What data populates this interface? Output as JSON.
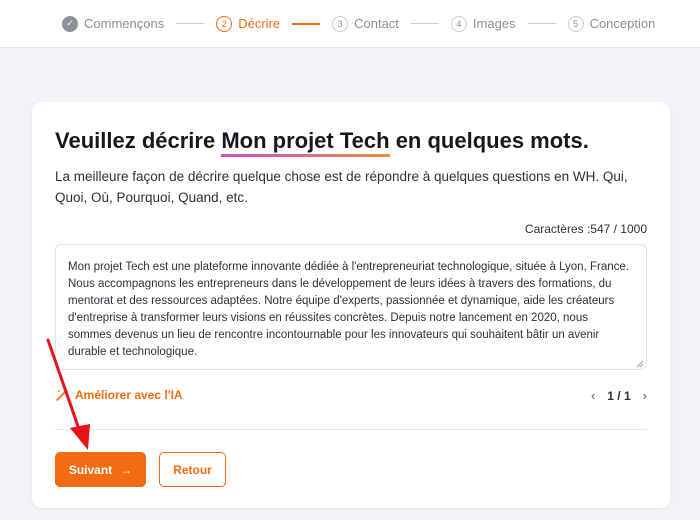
{
  "stepper": {
    "steps": [
      {
        "num": "✓",
        "label": "Commençons",
        "state": "done"
      },
      {
        "num": "2",
        "label": "Décrire",
        "state": "active"
      },
      {
        "num": "3",
        "label": "Contact",
        "state": "todo"
      },
      {
        "num": "4",
        "label": "Images",
        "state": "todo"
      },
      {
        "num": "5",
        "label": "Conception",
        "state": "todo"
      }
    ]
  },
  "card": {
    "title_pre": "Veuillez décrire ",
    "title_project": "Mon projet Tech",
    "title_post": " en quelques mots.",
    "subtitle": "La meilleure façon de décrire quelque chose est de répondre à quelques questions en WH. Qui, Quoi, Où, Pourquoi, Quand, etc.",
    "counter": "Caractères :547 / 1000",
    "description": "Mon projet Tech est une plateforme innovante dédiée à l'entrepreneuriat technologique, située à Lyon, France. Nous accompagnons les entrepreneurs dans le développement de leurs idées à travers des formations, du mentorat et des ressources adaptées. Notre équipe d'experts, passionnée et dynamique, aide les créateurs d'entreprise à transformer leurs visions en réussites concrètes. Depuis notre lancement en 2020, nous sommes devenus un lieu de rencontre incontournable pour les innovateurs qui souhaitent bâtir un avenir durable et technologique.",
    "ai_label": "Améliorer avec l'IA",
    "pager": "1 / 1",
    "next_label": "Suivant",
    "back_label": "Retour"
  },
  "colors": {
    "accent": "#f26b10",
    "annotation_arrow": "#e8141b"
  },
  "icons": [
    "check-icon",
    "magic-wand-icon",
    "chevron-left-icon",
    "chevron-right-icon",
    "arrow-right-icon"
  ]
}
